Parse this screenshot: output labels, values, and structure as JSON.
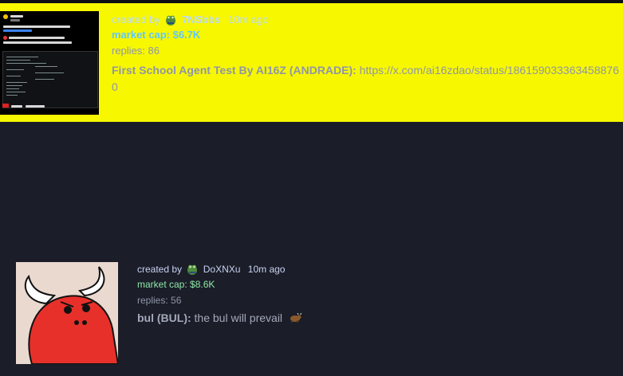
{
  "cards": [
    {
      "creator_prefix": "created by",
      "creator_name": "7NSbbs",
      "age": "10m ago",
      "market_cap": "market cap: $6.7K",
      "replies": "replies: 86",
      "token_name": "First School Agent Test By AI16Z (ANDRADE):",
      "description": "https://x.com/ai16zdao/status/1861590333634588760",
      "highlight_color": "#f7f700",
      "thumbnail": {
        "tweet_handle": "ai16z",
        "tweet_text": "all tutorial on building your own AI agent from scratch",
        "embedded_text": "AI Agent Dev School"
      }
    },
    {
      "creator_prefix": "created by",
      "creator_name": "DoXNXu",
      "age": "10m ago",
      "market_cap": "market cap: $8.6K",
      "replies": "replies: 56",
      "token_name": "bul (BUL):",
      "description": "the bul will prevail",
      "emoji_icon": "ox-icon"
    }
  ],
  "colors": {
    "background": "#1b1d28",
    "highlight": "#f7f700",
    "market_cap_green": "#8ee6a8",
    "bull_red": "#e8302b"
  }
}
